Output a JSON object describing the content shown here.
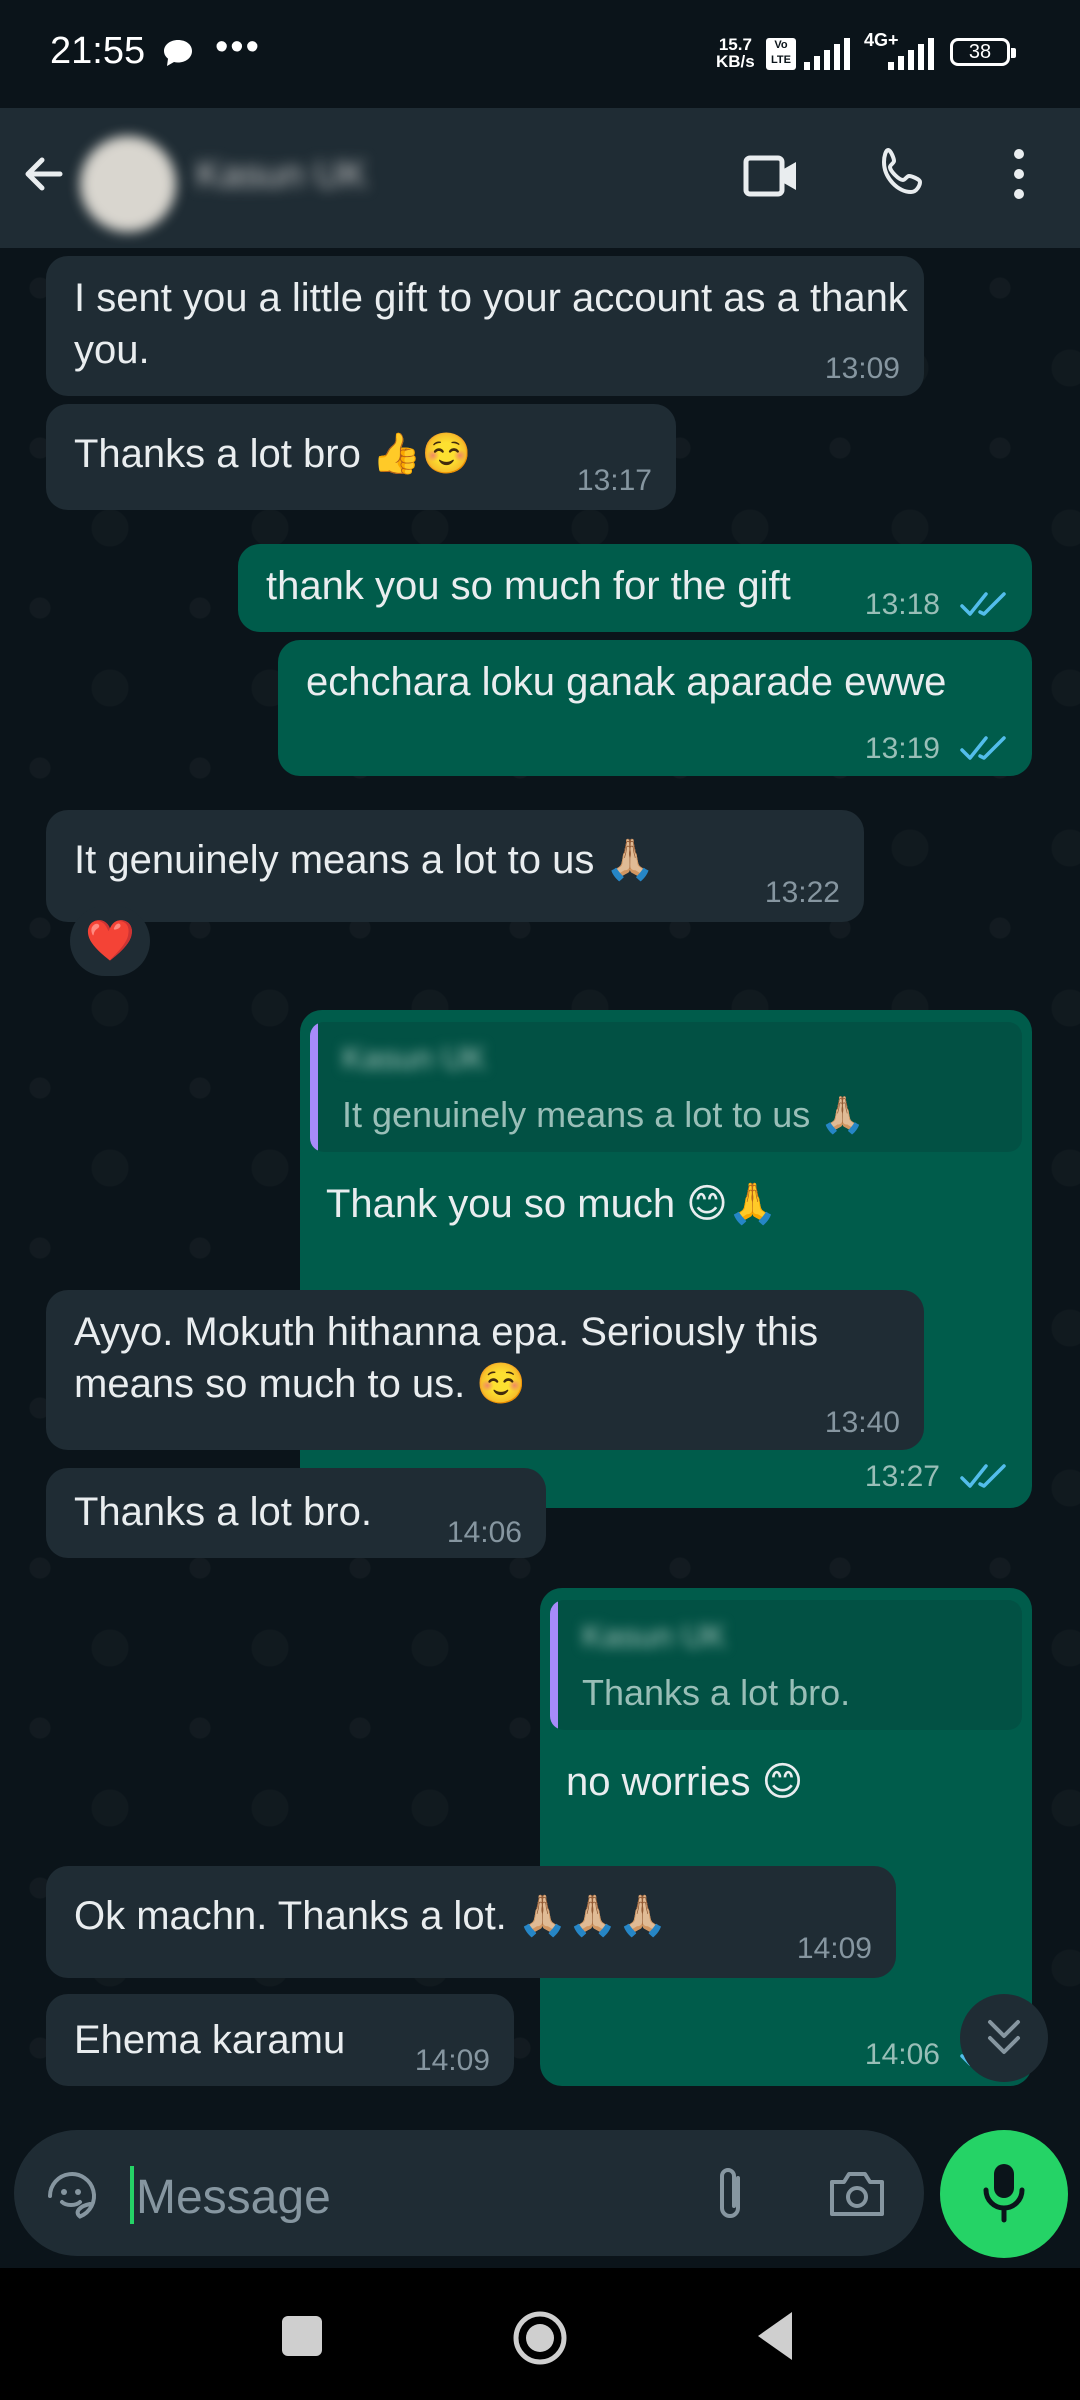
{
  "status_bar": {
    "time": "21:55",
    "speed_value": "15.7",
    "speed_unit": "KB/s",
    "volte": "Vo LTE",
    "network": "4G+",
    "battery": "38"
  },
  "header": {
    "contact_name": "Kasun UK",
    "icons": [
      "back-arrow-icon",
      "video-call-icon",
      "voice-call-icon",
      "more-options-icon"
    ]
  },
  "messages": [
    {
      "dir": "in",
      "text": "I sent you a little gift to your account as a thank you.",
      "time": "13:09"
    },
    {
      "dir": "in",
      "text": "Thanks a lot bro 👍☺️",
      "time": "13:17"
    },
    {
      "dir": "out",
      "text": "thank you so much for the gift",
      "time": "13:18",
      "status": "read"
    },
    {
      "dir": "out",
      "text": "echchara loku ganak aparade ewwe",
      "time": "13:19",
      "status": "read"
    },
    {
      "dir": "in",
      "text": "It genuinely means a lot to us 🙏🏼",
      "time": "13:22",
      "reaction": "❤️"
    },
    {
      "dir": "out",
      "quoted_name": "Kasun UK",
      "quoted_text": "It genuinely means a lot to us 🙏🏼",
      "text": "Thank you so much 😊🙏",
      "time": "13:27",
      "status": "read"
    },
    {
      "dir": "in",
      "text": "Ayyo. Mokuth hithanna epa. Seriously this means so much to us. ☺️",
      "time": "13:40"
    },
    {
      "dir": "in",
      "text": "Thanks a lot bro.",
      "time": "14:06"
    },
    {
      "dir": "out",
      "quoted_name": "Kasun UK",
      "quoted_text": "Thanks a lot bro.",
      "text": "no worries 😊",
      "time": "14:06",
      "status": "read"
    },
    {
      "dir": "in",
      "text": "Ok machn. Thanks a lot. 🙏🏼🙏🏼🙏🏼",
      "time": "14:09"
    },
    {
      "dir": "in",
      "text": "Ehema karamu",
      "time": "14:09"
    }
  ],
  "composer": {
    "placeholder": "Message",
    "icons": [
      "sticker-emoji-icon",
      "attach-icon",
      "camera-icon",
      "mic-icon"
    ]
  },
  "colors": {
    "background": "#0b141a",
    "incoming_bubble": "#1f2c34",
    "outgoing_bubble": "#005c4b",
    "accent_green": "#25d366",
    "read_ticks": "#53bdeb"
  }
}
